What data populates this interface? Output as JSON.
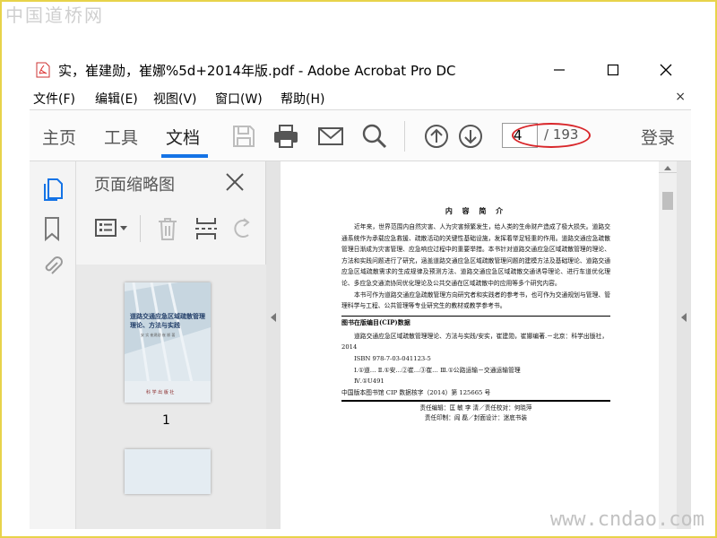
{
  "watermark": {
    "top": "中国道桥网",
    "bottom": "www.cndao.com"
  },
  "window": {
    "title": "实，崔建勋，崔娜%5d+2014年版.pdf - Adobe Acrobat Pro DC"
  },
  "menu": {
    "items": [
      "文件(F)",
      "编辑(E)",
      "视图(V)",
      "窗口(W)",
      "帮助(H)"
    ],
    "close": "×"
  },
  "toolbar": {
    "tabs": [
      "主页",
      "工具",
      "文档"
    ],
    "active_tab": "文档",
    "page_current": "4",
    "page_total": "/ 193",
    "login": "登录"
  },
  "panel": {
    "title": "页面缩略图",
    "thumb_label": "1",
    "thumb_title_line1": "道路交通应急区域疏散管理",
    "thumb_title_line2": "理论、方法与实践",
    "thumb_authors": "安 实  崔建勋  崔 娜  著",
    "thumb_publisher": "科 学 出 版 社"
  },
  "document": {
    "heading": "内 容 简 介",
    "para1": "近年来，世界范围内自然灾害、人为灾害频繁发生，给人类的生命财产造成了极大损失。道路交通系统作为承载应急救援、疏散活动的关键性基础设施，发挥着举足轻重的作用。道路交通应急疏散管理日渐成为灾害管理、应急响应过程中的重要举措。本书针对道路交通应急区域疏散管理的理论、方法和实践问题进行了研究，涵盖道路交通应急区域疏散管理问题的建模方法及基础理论、道路交通应急区域疏散需求的生成规律及预测方法、道路交通应急区域疏散交通诱导理论、进行车道优化理论、多应急交通流协同优化理论及公共交通在区域疏散中的应用等多个研究内容。",
    "para2": "本书可作为道路交通应急疏散管理方向研究者和实践者的参考书，也可作为交通规划与管理、管理科学与工程、公共管理等专业研究生的教材或教学参考书。",
    "cip_title": "图书在版编目(CIP)数据",
    "cip1": "道路交通应急区域疏散管理理论、方法与实践/安实，崔建勋，崔娜编著.－北京：科学出版社，2014",
    "cip2": "ISBN 978-7-03-041123-5",
    "cip3": "Ⅰ.①道…  Ⅱ.①安…②崔…③崔…  Ⅲ.①公路运输－交通运输管理",
    "cip4": "Ⅳ.①U491",
    "cip5": "中国版本图书馆 CIP 数据核字（2014）第 125665 号",
    "credits1": "责任编辑：匡  敏  李  清／责任校对：何晓萍",
    "credits2": "责任印制：阎  磊／封面设计：迷底书装"
  },
  "colors": {
    "accent": "#1473e6",
    "annotation": "#d8262a",
    "watermark_border": "#e8d34a"
  }
}
